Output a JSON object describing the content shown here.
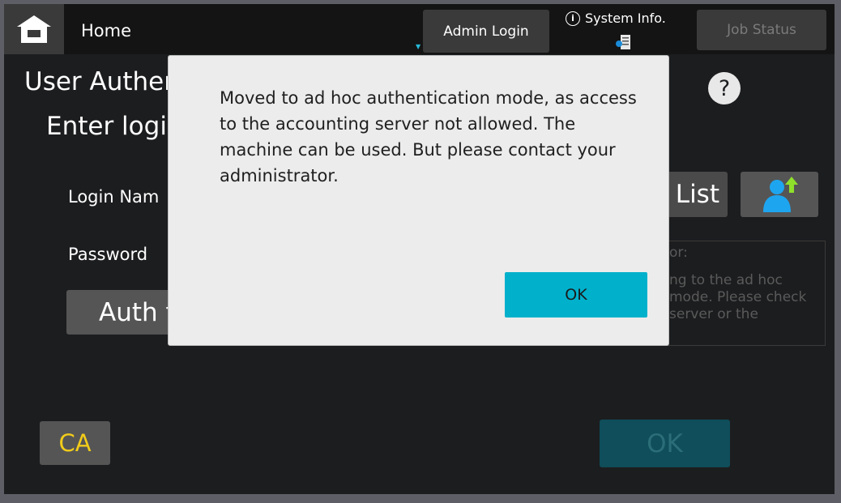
{
  "topbar": {
    "home_label": "Home",
    "admin_login_label": "Admin Login",
    "system_info_label": "System Info.",
    "job_status_label": "Job Status"
  },
  "background": {
    "title": "User Authen",
    "subtitle": "Enter logi",
    "login_name_label": "Login Nam",
    "password_label": "Password",
    "auth_button_label": "Auth t",
    "list_button_label": "n List",
    "error_heading": "or:",
    "error_body": "ng to the ad hoc mode. Please check server or the",
    "ca_label": "CA",
    "ok_label": "OK"
  },
  "modal": {
    "message": "Moved to ad hoc authentication mode, as access to the accounting server not allowed. The machine can be used. But please contact your administrator.",
    "ok_label": "OK"
  },
  "colors": {
    "accent": "#01b1cc",
    "ca_text": "#f2cc1a",
    "screen_bg": "#1c1d1f"
  },
  "icons": [
    "home-icon",
    "info-icon",
    "device-icon",
    "help-icon",
    "user-list-icon"
  ]
}
